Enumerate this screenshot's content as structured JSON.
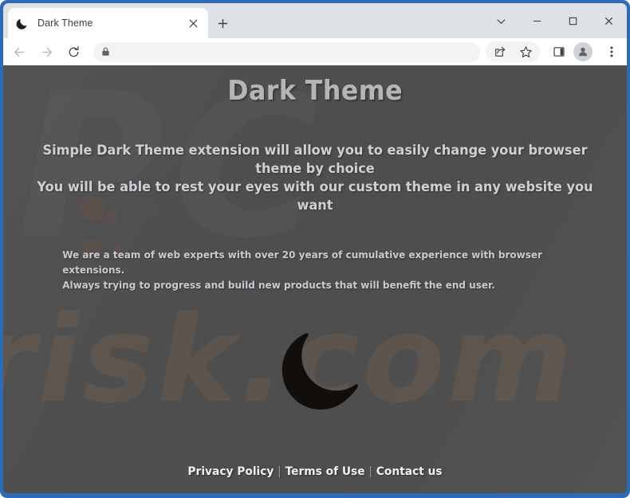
{
  "browser": {
    "tab": {
      "title": "Dark Theme",
      "favicon_icon": "crescent-moon-icon",
      "close_icon": "close-icon"
    },
    "new_tab_icon": "plus-icon",
    "window_controls": [
      {
        "name": "tab-search",
        "icon": "chevron-down-icon"
      },
      {
        "name": "minimize",
        "icon": "minimize-icon"
      },
      {
        "name": "maximize",
        "icon": "maximize-icon"
      },
      {
        "name": "close",
        "icon": "close-icon"
      }
    ],
    "toolbar": {
      "back_icon": "back-arrow-icon",
      "forward_icon": "forward-arrow-icon",
      "reload_icon": "reload-icon",
      "omnibox": {
        "security_icon": "lock-icon",
        "value": "",
        "placeholder": ""
      },
      "share_icon": "share-icon",
      "bookmark_icon": "star-icon",
      "side_panel_icon": "side-panel-icon",
      "profile_icon": "profile-avatar-icon",
      "menu_icon": "three-dot-menu-icon"
    }
  },
  "page": {
    "headline": "Dark Theme",
    "lead_line_1": "Simple Dark Theme extension will allow you to easily change your browser theme by choice",
    "lead_line_2": "You will be able to rest your eyes with our custom theme in any website you want",
    "blurb_line_1": "We are a team of web experts with over 20 years of cumulative experience with browser extensions.",
    "blurb_line_2": "Always trying to progress and build new products that will benefit the end user.",
    "logo_icon": "crescent-moon-icon",
    "watermark_top": "PC",
    "watermark_bottom": "risk.com",
    "footer": {
      "privacy_policy": "Privacy Policy",
      "separator": "|",
      "terms_of_use": "Terms of Use",
      "contact_us": "Contact us"
    },
    "colors": {
      "page_background": "#4f4e4e",
      "headline": "#b5b5b5",
      "body_text": "#cfcfd6",
      "footer_text": "#f0f0f2",
      "window_border": "#2d6cb5",
      "moon": "#100d0b"
    }
  }
}
